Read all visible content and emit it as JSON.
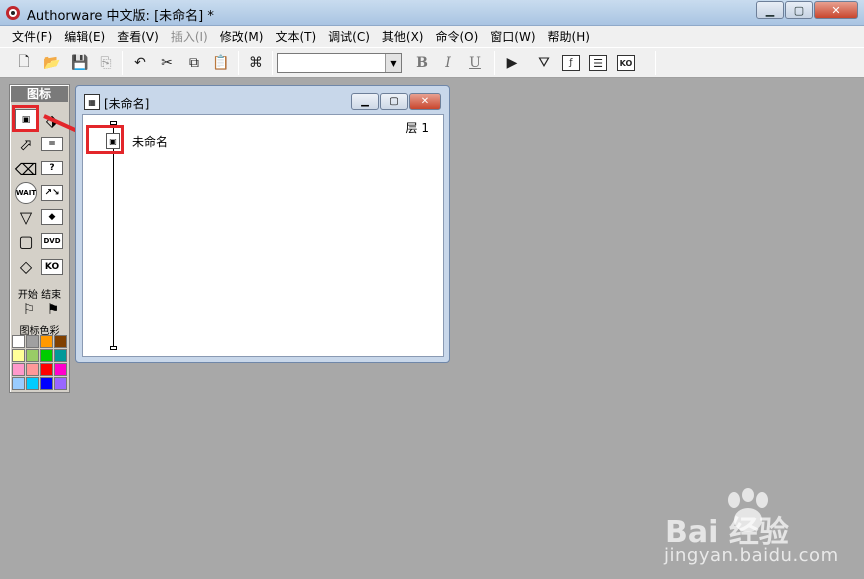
{
  "window": {
    "title": "Authorware 中文版: [未命名] *"
  },
  "menu": [
    {
      "label": "文件(F)",
      "enabled": true
    },
    {
      "label": "编辑(E)",
      "enabled": true
    },
    {
      "label": "查看(V)",
      "enabled": true
    },
    {
      "label": "插入(I)",
      "enabled": false
    },
    {
      "label": "修改(M)",
      "enabled": true
    },
    {
      "label": "文本(T)",
      "enabled": true
    },
    {
      "label": "调试(C)",
      "enabled": true
    },
    {
      "label": "其他(X)",
      "enabled": true
    },
    {
      "label": "命令(O)",
      "enabled": true
    },
    {
      "label": "窗口(W)",
      "enabled": true
    },
    {
      "label": "帮助(H)",
      "enabled": true
    }
  ],
  "toolbar": {
    "font_value": "",
    "bold": "B",
    "italic": "I",
    "underline": "U",
    "icons": [
      "new-icon",
      "open-icon",
      "save-all-icon",
      "import-icon",
      "undo-icon",
      "cut-icon",
      "copy-icon",
      "paste-icon",
      "find-icon",
      "run-icon",
      "control-panel-icon",
      "functions-icon",
      "variables-icon",
      "knowledge-objects-icon"
    ]
  },
  "palette": {
    "title": "图标",
    "icons": [
      {
        "name": "display-icon",
        "glyph": "🖼"
      },
      {
        "name": "motion-icon",
        "glyph": "↗"
      },
      {
        "name": "erase-icon",
        "glyph": "✐"
      },
      {
        "name": "wait-icon",
        "glyph": "WAIT"
      },
      {
        "name": "navigate-icon",
        "glyph": "▽"
      },
      {
        "name": "framework-icon",
        "glyph": "▢"
      },
      {
        "name": "decision-icon",
        "glyph": "◇"
      },
      {
        "name": "interaction-icon",
        "glyph": "?"
      },
      {
        "name": "calculation-icon",
        "glyph": "="
      },
      {
        "name": "map-icon",
        "glyph": "▦"
      },
      {
        "name": "digital-movie-icon",
        "glyph": "▤"
      },
      {
        "name": "sound-icon",
        "glyph": "♪"
      },
      {
        "name": "dvd-icon",
        "glyph": "DVD"
      },
      {
        "name": "ko-icon",
        "glyph": "KO"
      }
    ],
    "start_end_label": "开始 结束",
    "start_flag": "⚐",
    "end_flag": "⚑",
    "color_label": "图标色彩",
    "colors": [
      "#ffffff",
      "#a0a0a0",
      "#ff9900",
      "#804000",
      "#ffff99",
      "#99cc66",
      "#00cc00",
      "#009999",
      "#ff99cc",
      "#ff9999",
      "#ff0000",
      "#ff00cc",
      "#99ccff",
      "#00ccff",
      "#0000ff",
      "#9966ff"
    ]
  },
  "flowchart_window": {
    "title": "[未命名]",
    "layer_label": "层 1",
    "icon_label": "未命名"
  },
  "watermark": {
    "brand": "Bai  经验",
    "url": "jingyan.baidu.com"
  }
}
